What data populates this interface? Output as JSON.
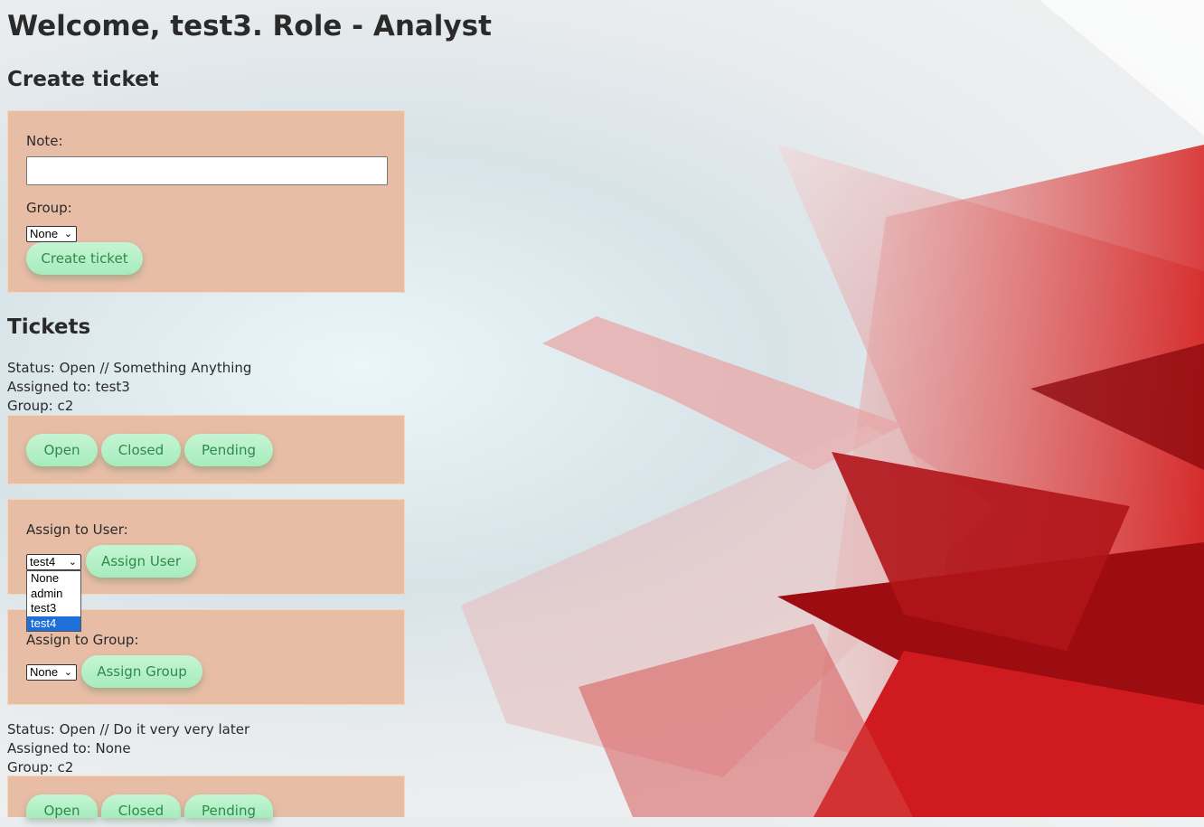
{
  "header": {
    "welcome": "Welcome, test3. Role - Analyst"
  },
  "create_ticket": {
    "title": "Create ticket",
    "note_label": "Note:",
    "note_value": "",
    "group_label": "Group:",
    "group_selected": "None",
    "submit_label": "Create ticket"
  },
  "tickets_section": {
    "title": "Tickets"
  },
  "tickets": [
    {
      "status_line": "Status: Open // Something Anything",
      "assigned_line": "Assigned to: test3",
      "group_line": "Group: c2",
      "status_buttons": [
        "Open",
        "Closed",
        "Pending"
      ],
      "assign_user_label": "Assign to User:",
      "assign_user_selected": "test4",
      "assign_user_button": "Assign User",
      "assign_user_options": [
        "None",
        "admin",
        "test3",
        "test4"
      ],
      "assign_group_label": "Assign to Group:",
      "assign_group_selected": "None",
      "assign_group_button": "Assign Group"
    },
    {
      "status_line": "Status: Open // Do it very very later",
      "assigned_line": "Assigned to: None",
      "group_line": "Group: c2",
      "status_buttons": [
        "Open",
        "Closed",
        "Pending"
      ]
    }
  ],
  "colors": {
    "panel": "#e8bda6",
    "button": "#b2f0c6",
    "button_text": "#2f8a4a",
    "accent_red": "#c0151a"
  }
}
